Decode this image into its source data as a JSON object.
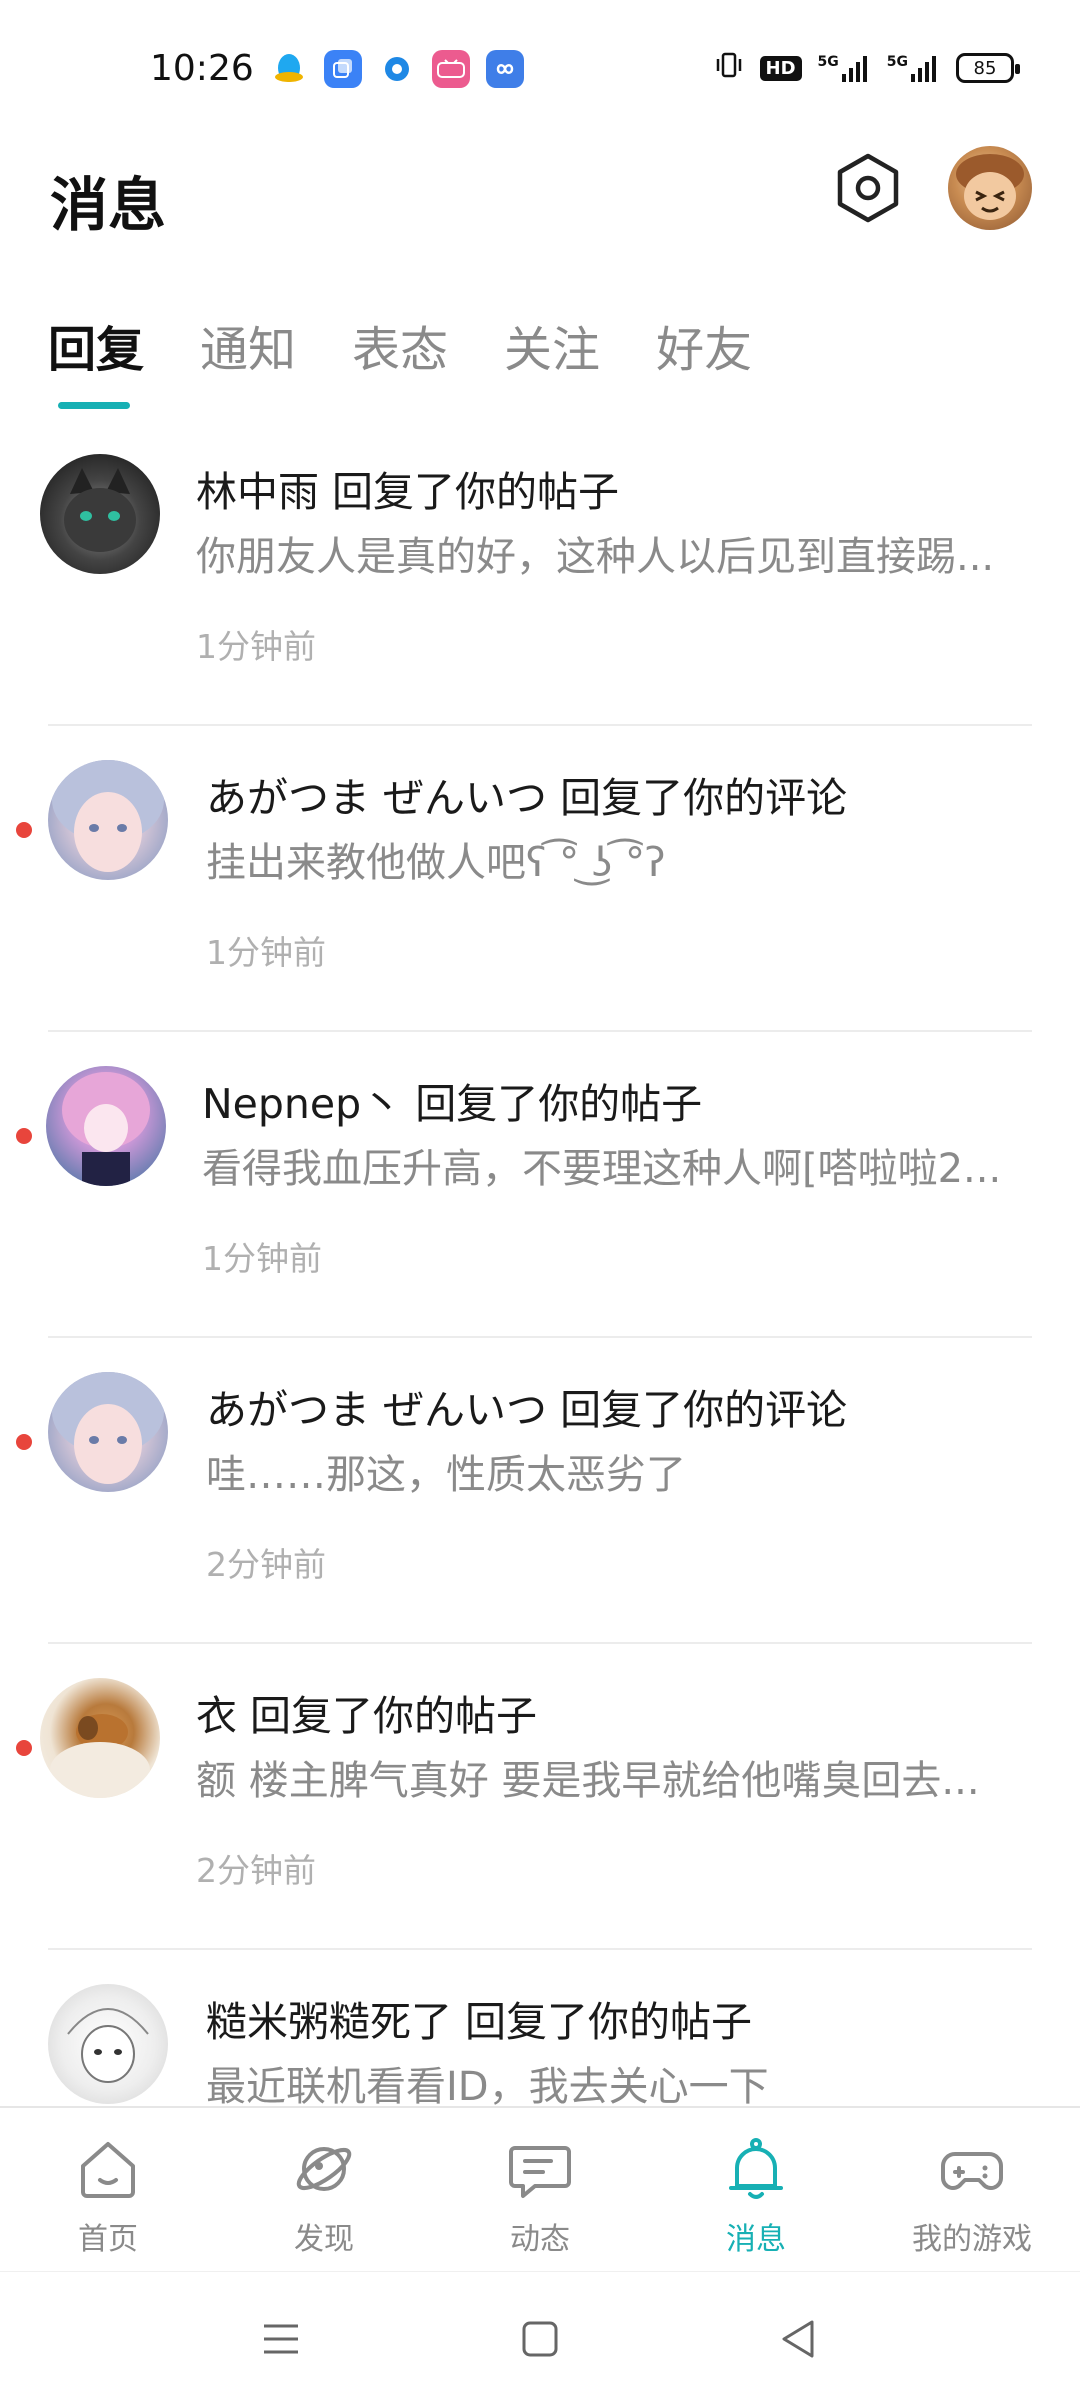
{
  "status_bar": {
    "time": "10:26",
    "network_hd": "HD",
    "signal_1": "5G",
    "signal_2": "5G",
    "battery": "85",
    "app_icons": [
      "qq-icon",
      "multi-window-icon",
      "dot-app-icon",
      "bilibili-icon",
      "infinity-app-icon"
    ]
  },
  "header": {
    "title": "消息"
  },
  "tabs": [
    {
      "label": "回复",
      "active": true
    },
    {
      "label": "通知",
      "active": false
    },
    {
      "label": "表态",
      "active": false
    },
    {
      "label": "关注",
      "active": false
    },
    {
      "label": "好友",
      "active": false
    }
  ],
  "messages": [
    {
      "title": "林中雨 回复了你的帖子",
      "body": "你朋友人是真的好，这种人以后见到直接踢...",
      "time": "1分钟前",
      "unread": false
    },
    {
      "title": "あがつま ぜんいつ 回复了你的评论",
      "body": "挂出来教他做人吧ʕ ͡° ͜ʖ ͡°ʔ",
      "time": "1分钟前",
      "unread": true
    },
    {
      "title": "Nepnep丶 回复了你的帖子",
      "body": "看得我血压升高，不要理这种人啊[嗒啦啦2...",
      "time": "1分钟前",
      "unread": true
    },
    {
      "title": "あがつま ぜんいつ 回复了你的评论",
      "body": "哇……那这，性质太恶劣了",
      "time": "2分钟前",
      "unread": true
    },
    {
      "title": "衣 回复了你的帖子",
      "body": "额 楼主脾气真好 要是我早就给他嘴臭回去...",
      "time": "2分钟前",
      "unread": true
    },
    {
      "title": "糙米粥糙死了 回复了你的帖子",
      "body": "最近联机看看ID，我去关心一下",
      "time": "",
      "unread": false
    }
  ],
  "bottom_nav": [
    {
      "label": "首页",
      "icon": "home-icon",
      "active": false
    },
    {
      "label": "发现",
      "icon": "discover-icon",
      "active": false
    },
    {
      "label": "动态",
      "icon": "feed-icon",
      "active": false
    },
    {
      "label": "消息",
      "icon": "bell-icon",
      "active": true
    },
    {
      "label": "我的游戏",
      "icon": "gamepad-icon",
      "active": false
    }
  ],
  "colors": {
    "accent": "#17b0b4",
    "unread_dot": "#e8453c",
    "muted_text": "#8a8a8a"
  }
}
